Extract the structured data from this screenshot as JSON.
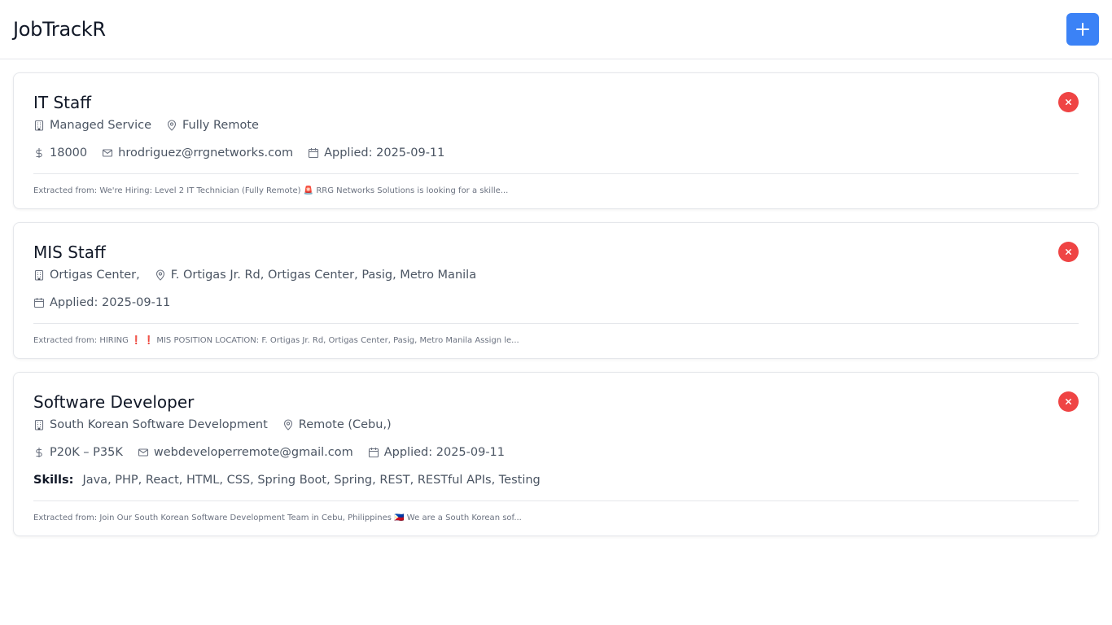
{
  "header": {
    "title": "JobTrackR",
    "add_icon": "plus-icon"
  },
  "colors": {
    "accent": "#3b82f6",
    "danger": "#ef4444"
  },
  "jobs": [
    {
      "title": "IT Staff",
      "company": "Managed Service",
      "location": "Fully Remote",
      "salary": "18000",
      "email": "hrodriguez@rrgnetworks.com",
      "applied": "Applied: 2025-09-11",
      "extracted": "Extracted from: We're Hiring: Level 2 IT Technician (Fully Remote) 🚨 RRG Networks Solutions is looking for a skille..."
    },
    {
      "title": "MIS Staff",
      "company": "Ortigas Center,",
      "location": "F. Ortigas Jr. Rd, Ortigas Center, Pasig, Metro Manila",
      "applied": "Applied: 2025-09-11",
      "extracted": "Extracted from: HIRING ❗ ❗ MIS POSITION LOCATION: F. Ortigas Jr. Rd, Ortigas Center, Pasig, Metro Manila Assign le..."
    },
    {
      "title": "Software Developer",
      "company": "South Korean Software Development",
      "location": "Remote (Cebu,)",
      "salary": "P20K – P35K",
      "email": "webdeveloperremote@gmail.com",
      "applied": "Applied: 2025-09-11",
      "skills_label": "Skills:",
      "skills": "Java, PHP, React, HTML, CSS, Spring Boot, Spring, REST, RESTful APIs, Testing",
      "extracted": "Extracted from: Join Our South Korean Software Development Team in Cebu, Philippines 🇵🇭 We are a South Korean sof..."
    }
  ]
}
